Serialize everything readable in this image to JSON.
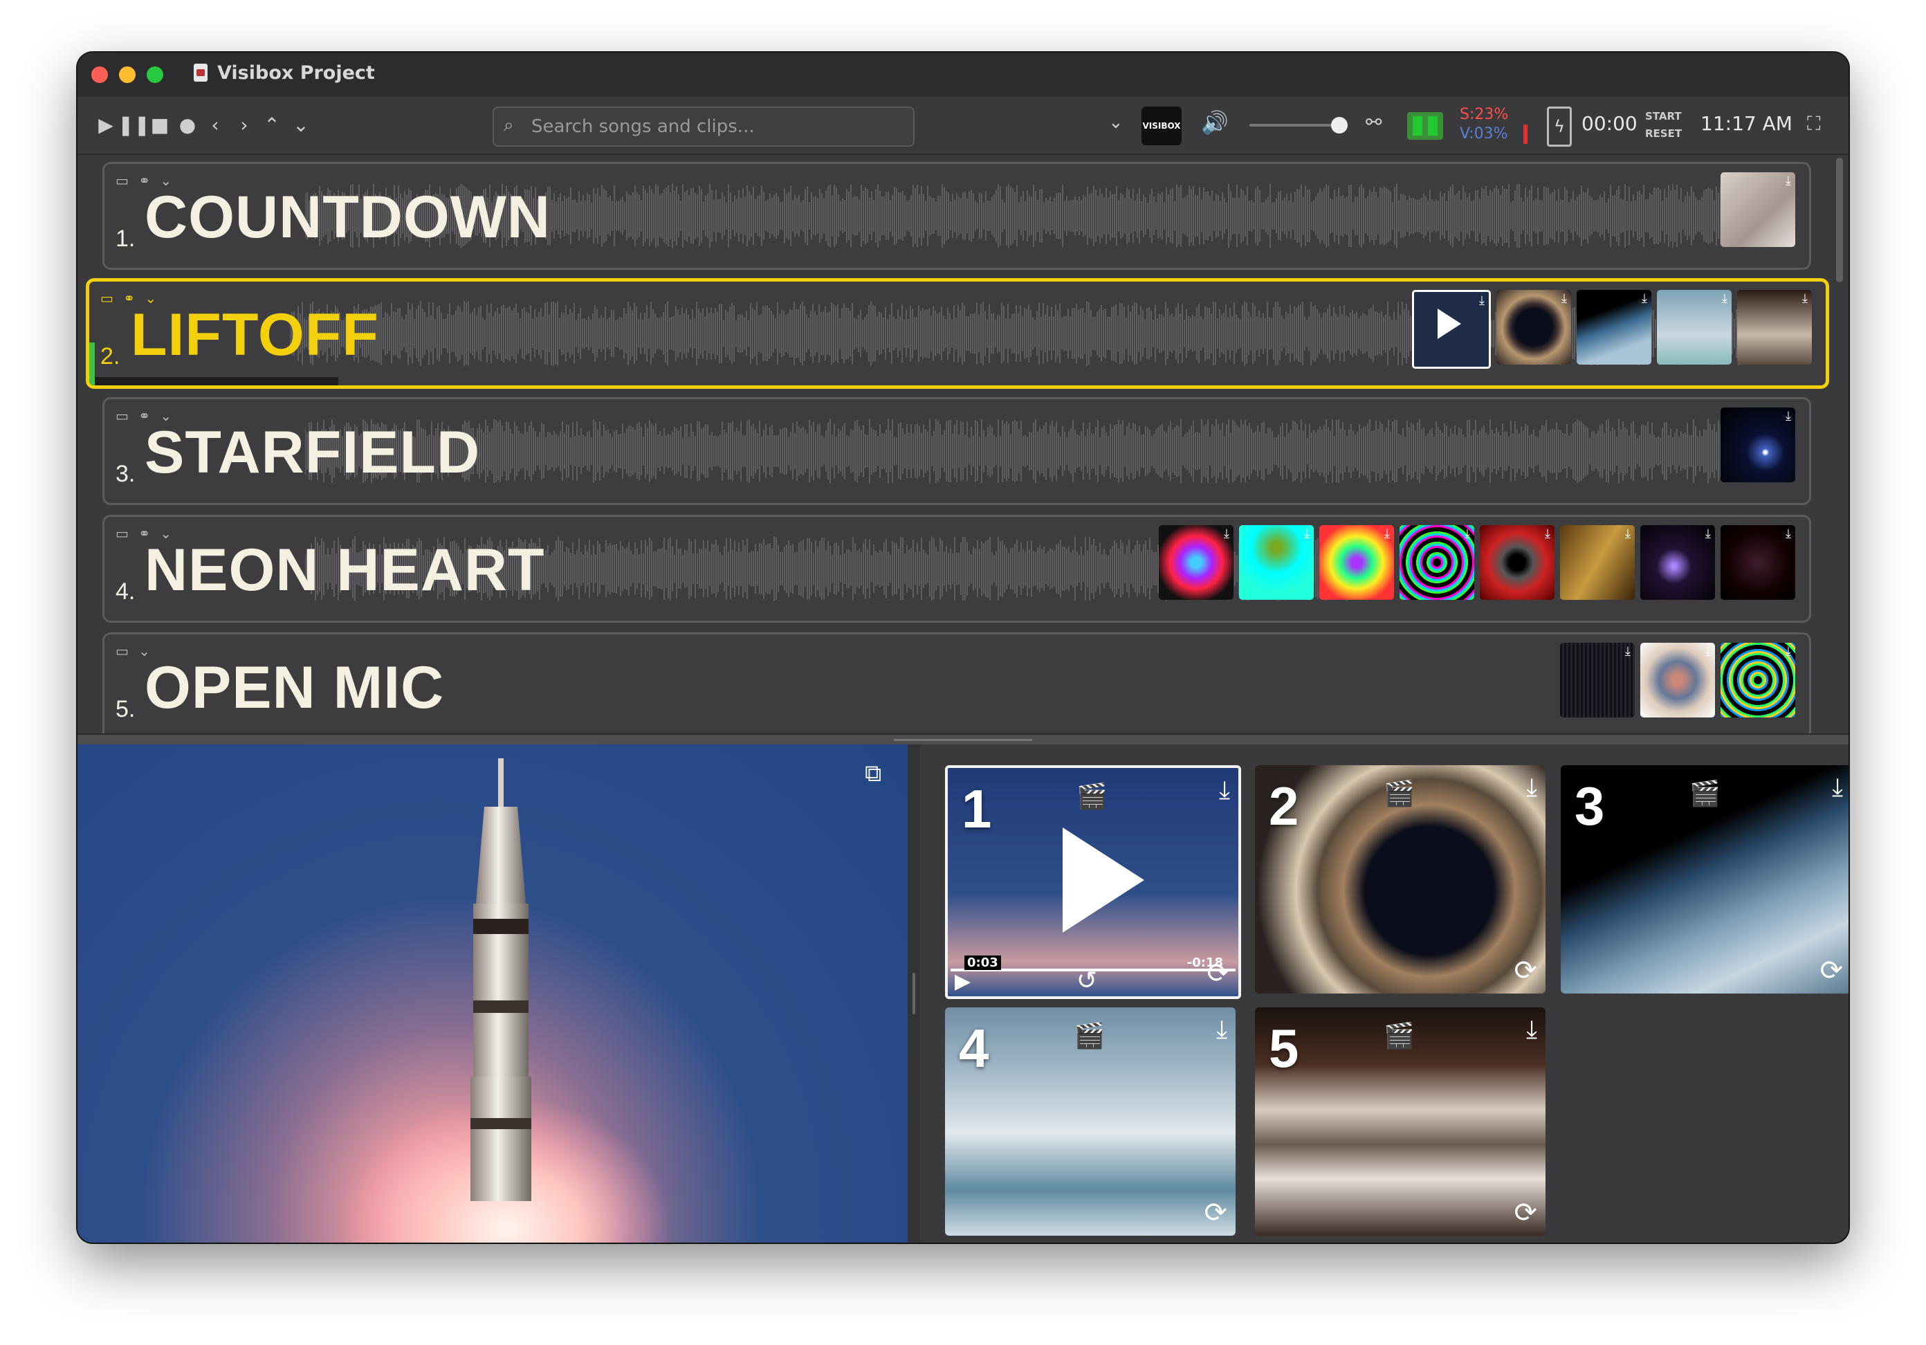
{
  "window": {
    "title": "Visibox Project"
  },
  "toolbar": {
    "search_placeholder": "Search songs and clips...",
    "logo_text": "VISIBOX",
    "stat_s": "S:23%",
    "stat_v": "V:03%",
    "timer": "00:00",
    "start_label": "START",
    "reset_label": "RESET",
    "clock": "11:17 AM"
  },
  "songs": [
    {
      "number": "1.",
      "title": "COUNTDOWN",
      "selected": false
    },
    {
      "number": "2.",
      "title": "LIFTOFF",
      "selected": true
    },
    {
      "number": "3.",
      "title": "STARFIELD",
      "selected": false
    },
    {
      "number": "4.",
      "title": "NEON HEART",
      "selected": false
    },
    {
      "number": "5.",
      "title": "OPEN MIC",
      "selected": false
    }
  ],
  "clips": [
    {
      "number": "1",
      "elapsed": "0:03",
      "remaining": "-0:18",
      "active": true
    },
    {
      "number": "2",
      "active": false
    },
    {
      "number": "3",
      "active": false
    },
    {
      "number": "4",
      "active": false
    },
    {
      "number": "5",
      "active": false
    }
  ],
  "colors": {
    "accent": "#f2d00b",
    "background": "#3a3a3c",
    "stat_s": "#ff4d4d",
    "stat_v": "#5b7fd6"
  }
}
